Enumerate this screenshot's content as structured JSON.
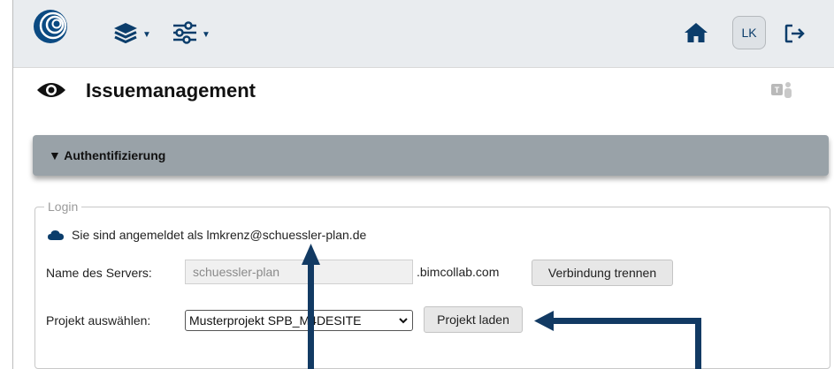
{
  "colors": {
    "navy": "#0b3d6b",
    "navbar_bg": "#e9ecef",
    "accordion_bg": "#99a2a8",
    "arrow": "#123a63"
  },
  "navbar": {
    "logo_icon": "swirl-logo-icon",
    "layers_icon": "layers-icon",
    "settings_icon": "sliders-icon",
    "home_icon": "home-icon",
    "avatar_initials": "LK",
    "logout_icon": "logout-icon"
  },
  "header": {
    "title": "Issuemanagement",
    "view_icon": "eye-icon",
    "teams_icon": "teams-icon"
  },
  "accordion": {
    "label": "▼ Authentifizierung"
  },
  "login": {
    "legend": "Login",
    "status_icon": "cloud-icon",
    "status_text": "Sie sind angemeldet als lmkrenz@schuessler-plan.de",
    "server_label": "Name des Servers:",
    "server_value": "schuessler-plan",
    "server_suffix": ".bimcollab.com",
    "disconnect_button": "Verbindung trennen",
    "project_label": "Projekt auswählen:",
    "project_selected": "Musterprojekt SPB_M4DESITE",
    "load_button": "Projekt laden"
  }
}
